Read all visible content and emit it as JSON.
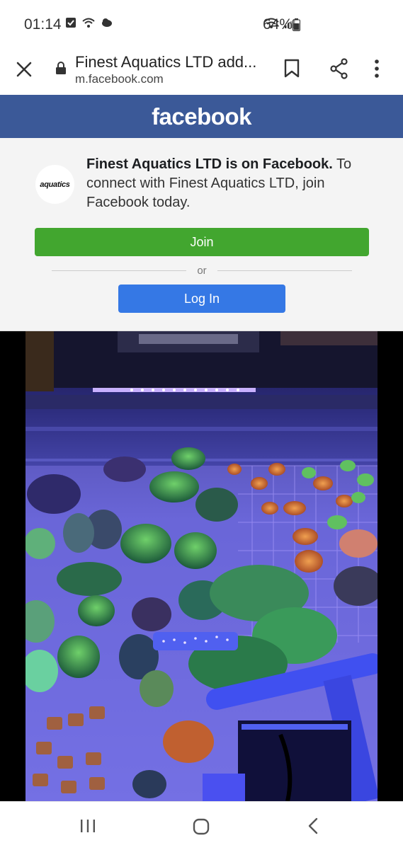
{
  "status_bar": {
    "time": "01:14",
    "battery_percent": "64%"
  },
  "browser": {
    "title": "Finest Aquatics LTD add...",
    "url": "m.facebook.com"
  },
  "facebook": {
    "logo_text": "facebook",
    "brand_color": "#3b5998"
  },
  "panel": {
    "avatar_text": "aquatics",
    "page_name_bold": "Finest Aquatics LTD is on Facebook.",
    "message_rest": " To connect with Finest Aquatics LTD, join Facebook today.",
    "join_label": "Join",
    "join_color": "#42a62f",
    "or_label": "or",
    "login_label": "Log In",
    "login_color": "#3578e5"
  },
  "photo": {
    "description_icon": "coral-tank-photo"
  },
  "nav": {
    "recent_icon": "recent-apps-icon",
    "home_icon": "home-icon",
    "back_icon": "back-icon"
  }
}
